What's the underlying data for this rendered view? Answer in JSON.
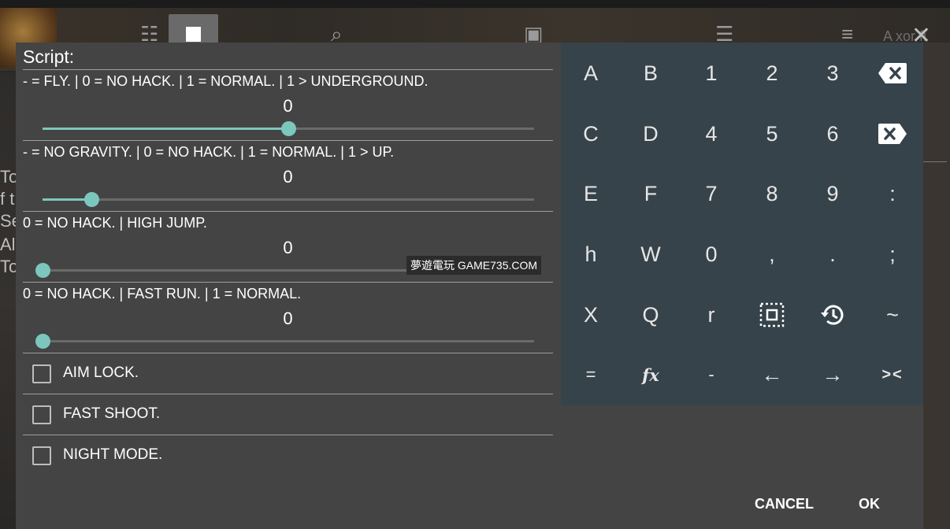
{
  "banner": {
    "url": "http://gameguardian.net/download"
  },
  "background": {
    "search_hint": "A  xor fi",
    "side_text": [
      "To",
      "f t",
      "Se",
      "Als",
      "To"
    ]
  },
  "dialog": {
    "title": "Script:",
    "sliders": [
      {
        "label": "- = FLY. | 0 = NO HACK. | 1 = NORMAL. | 1 > UNDERGROUND.",
        "value": "0",
        "position_fraction": 0.5
      },
      {
        "label": "- = NO GRAVITY. | 0 = NO HACK. | 1 = NORMAL. | 1 > UP.",
        "value": "0",
        "position_fraction": 0.1
      },
      {
        "label": "0 = NO HACK. | HIGH JUMP.",
        "value": "0",
        "position_fraction": 0.0
      },
      {
        "label": "0 = NO HACK. | FAST RUN. | 1 = NORMAL.",
        "value": "0",
        "position_fraction": 0.0
      }
    ],
    "checkboxes": [
      {
        "label": "AIM LOCK.",
        "checked": false
      },
      {
        "label": "FAST SHOOT.",
        "checked": false
      },
      {
        "label": "NIGHT MODE.",
        "checked": false
      }
    ],
    "watermark": "夢遊電玩 GAME735.COM",
    "buttons": {
      "cancel": "CANCEL",
      "ok": "OK"
    }
  },
  "keyboard": {
    "rows": [
      [
        {
          "label": "A"
        },
        {
          "label": "B"
        },
        {
          "label": "1"
        },
        {
          "label": "2"
        },
        {
          "label": "3"
        },
        {
          "icon": "backspace-icon"
        }
      ],
      [
        {
          "label": "C"
        },
        {
          "label": "D"
        },
        {
          "label": "4"
        },
        {
          "label": "5"
        },
        {
          "label": "6"
        },
        {
          "icon": "delete-forward-icon"
        }
      ],
      [
        {
          "label": "E"
        },
        {
          "label": "F"
        },
        {
          "label": "7"
        },
        {
          "label": "8"
        },
        {
          "label": "9"
        },
        {
          "label": ":"
        }
      ],
      [
        {
          "label": "h"
        },
        {
          "label": "W"
        },
        {
          "label": "0"
        },
        {
          "label": ","
        },
        {
          "label": "."
        },
        {
          "label": ";"
        }
      ],
      [
        {
          "label": "X"
        },
        {
          "label": "Q"
        },
        {
          "label": "r"
        },
        {
          "icon": "select-all-icon"
        },
        {
          "icon": "history-icon"
        },
        {
          "label": "~"
        }
      ],
      [
        {
          "label": "="
        },
        {
          "label": "fx"
        },
        {
          "label": "-"
        },
        {
          "label": "←"
        },
        {
          "label": "→"
        },
        {
          "label": "><"
        }
      ]
    ]
  },
  "colors": {
    "accent": "#7cc7bd",
    "dialog_bg": "#444444",
    "keyboard_bg": "#37434a"
  }
}
